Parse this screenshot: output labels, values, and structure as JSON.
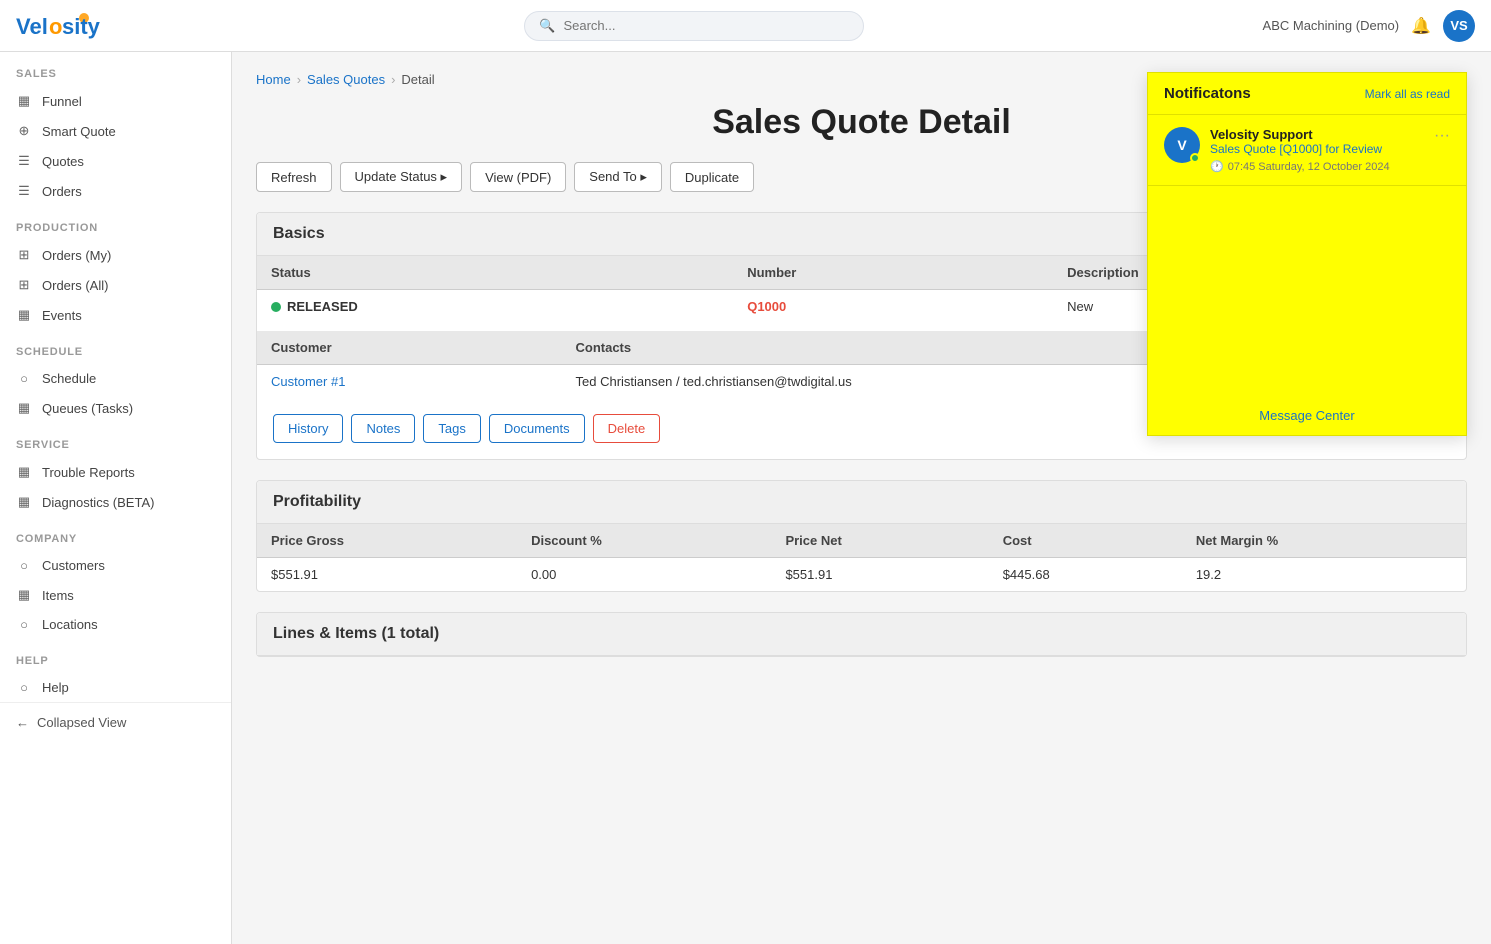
{
  "topbar": {
    "logo": "Vel",
    "logo_accent": "osity",
    "search_placeholder": "Search...",
    "company": "ABC Machining (Demo)",
    "avatar_initials": "VS"
  },
  "sidebar": {
    "sections": [
      {
        "label": "SALES",
        "items": [
          {
            "id": "funnel",
            "label": "Funnel",
            "icon": "▦"
          },
          {
            "id": "smart-quote",
            "label": "Smart Quote",
            "icon": "⊕"
          },
          {
            "id": "quotes",
            "label": "Quotes",
            "icon": "☰"
          },
          {
            "id": "orders",
            "label": "Orders",
            "icon": "☰"
          }
        ]
      },
      {
        "label": "PRODUCTION",
        "items": [
          {
            "id": "orders-my",
            "label": "Orders (My)",
            "icon": "⊞"
          },
          {
            "id": "orders-all",
            "label": "Orders (All)",
            "icon": "⊞"
          },
          {
            "id": "events",
            "label": "Events",
            "icon": "▦"
          }
        ]
      },
      {
        "label": "SCHEDULE",
        "items": [
          {
            "id": "schedule",
            "label": "Schedule",
            "icon": "○"
          },
          {
            "id": "queues-tasks",
            "label": "Queues (Tasks)",
            "icon": "▦"
          }
        ]
      },
      {
        "label": "SERVICE",
        "items": [
          {
            "id": "trouble-reports",
            "label": "Trouble Reports",
            "icon": "▦"
          },
          {
            "id": "diagnostics-beta",
            "label": "Diagnostics (BETA)",
            "icon": "▦"
          }
        ]
      },
      {
        "label": "COMPANY",
        "items": [
          {
            "id": "customers",
            "label": "Customers",
            "icon": "○"
          },
          {
            "id": "items",
            "label": "Items",
            "icon": "▦"
          },
          {
            "id": "locations",
            "label": "Locations",
            "icon": "○"
          }
        ]
      },
      {
        "label": "HELP",
        "items": [
          {
            "id": "help",
            "label": "Help",
            "icon": "○"
          }
        ]
      }
    ],
    "collapsed_label": "Collapsed View"
  },
  "breadcrumb": {
    "home": "Home",
    "sales_quotes": "Sales Quotes",
    "detail": "Detail"
  },
  "page": {
    "title": "Sales Quote Detail"
  },
  "action_buttons": {
    "refresh": "Refresh",
    "update_status": "Update Status ▸",
    "view_pdf": "View (PDF)",
    "send_to": "Send To ▸",
    "duplicate": "Duplicate"
  },
  "basics": {
    "section_title": "Basics",
    "table_headers": [
      "Status",
      "Number",
      "Description"
    ],
    "row": {
      "status": "RELEASED",
      "number": "Q1000",
      "description": "New"
    },
    "contacts_headers": [
      "Customer",
      "Contacts"
    ],
    "contacts_row": {
      "customer": "Customer #1",
      "contacts": "Ted Christiansen / ted.christiansen@twdigital.us"
    }
  },
  "tab_buttons": {
    "history": "History",
    "notes": "Notes",
    "tags": "Tags",
    "documents": "Documents",
    "delete": "Delete"
  },
  "profitability": {
    "section_title": "Profitability",
    "headers": [
      "Price Gross",
      "Discount %",
      "Price Net",
      "Cost",
      "Net Margin %"
    ],
    "row": {
      "price_gross": "$551.91",
      "discount": "0.00",
      "price_net": "$551.91",
      "cost": "$445.68",
      "net_margin": "19.2"
    }
  },
  "lines_items": {
    "section_title": "Lines & Items (1 total)"
  },
  "notifications": {
    "title": "Notificatons",
    "mark_all_read": "Mark all as read",
    "item": {
      "sender": "Velosity Support",
      "message": "Sales Quote [Q1000] for Review",
      "time": "07:45 Saturday, 12 October 2024"
    },
    "footer_link": "Message Center"
  }
}
